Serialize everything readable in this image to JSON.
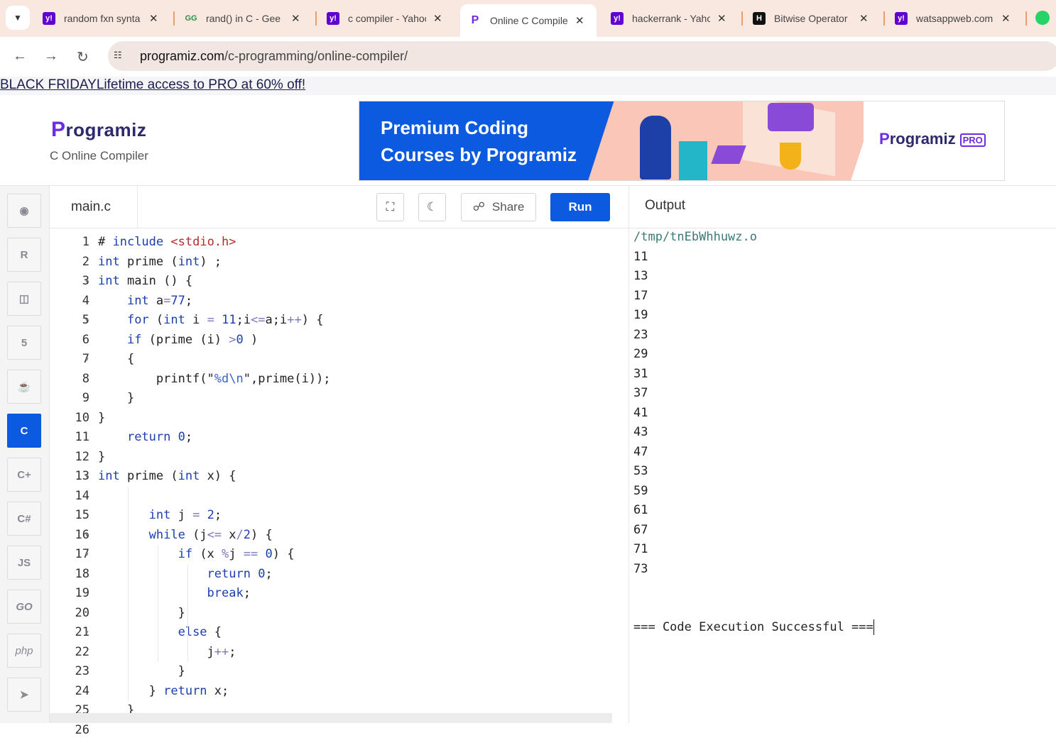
{
  "tabs": [
    {
      "title": "random fxn synta",
      "fav": "y!",
      "color": "#6001d2"
    },
    {
      "title": "rand() in C - Gee",
      "fav": "GG",
      "color": "#2f8d46"
    },
    {
      "title": "c compiler - Yahoo",
      "fav": "y!",
      "color": "#6001d2"
    },
    {
      "title": "Online C Compiler",
      "fav": "P",
      "color": "#6c2de0"
    },
    {
      "title": "hackerrank - Yahoo",
      "fav": "y!",
      "color": "#6001d2"
    },
    {
      "title": "Bitwise Operator",
      "fav": "H",
      "color": "#111111"
    },
    {
      "title": "watsappweb.com",
      "fav": "y!",
      "color": "#6001d2"
    }
  ],
  "address": {
    "domain": "programiz.com",
    "path": "/c-programming/online-compiler/"
  },
  "promo": "BLACK FRIDAYLifetime access to PRO at 60% off!",
  "header": {
    "logo": "rogramiz",
    "logo_p": "P",
    "subtitle": "C Online Compiler"
  },
  "banner": {
    "line1": "Premium Coding",
    "line2": "Courses by Programiz",
    "brand": "rogramiz",
    "brand_p": "P",
    "pro": "PRO"
  },
  "sidebar": {
    "js": "JS",
    "go": "GO",
    "php": "php"
  },
  "editor": {
    "filename": "main.c",
    "share": "Share",
    "run": "Run"
  },
  "code_lines": [
    "# include <stdio.h>",
    "int prime (int) ;",
    "int main () {",
    "    int a=77;",
    "    for (int i = 11;i<=a;i++) {",
    "    if (prime (i) >0 )",
    "    {",
    "        printf(\"%d\\n\",prime(i));",
    "    }",
    "}",
    "    return 0;",
    "}",
    "int prime (int x) {",
    "",
    "       int j = 2;",
    "       while (j<= x/2) {",
    "           if (x %j == 0) {",
    "               return 0;",
    "               break;",
    "           }",
    "           else {",
    "               j++;",
    "           }",
    "       } return x;",
    "    }",
    ""
  ],
  "output": {
    "title": "Output",
    "path": "/tmp/tnEbWhhuwz.o",
    "values": [
      "11",
      "13",
      "17",
      "19",
      "23",
      "29",
      "31",
      "37",
      "41",
      "43",
      "47",
      "53",
      "59",
      "61",
      "67",
      "71",
      "73"
    ],
    "status": "=== Code Execution Successful ==="
  }
}
